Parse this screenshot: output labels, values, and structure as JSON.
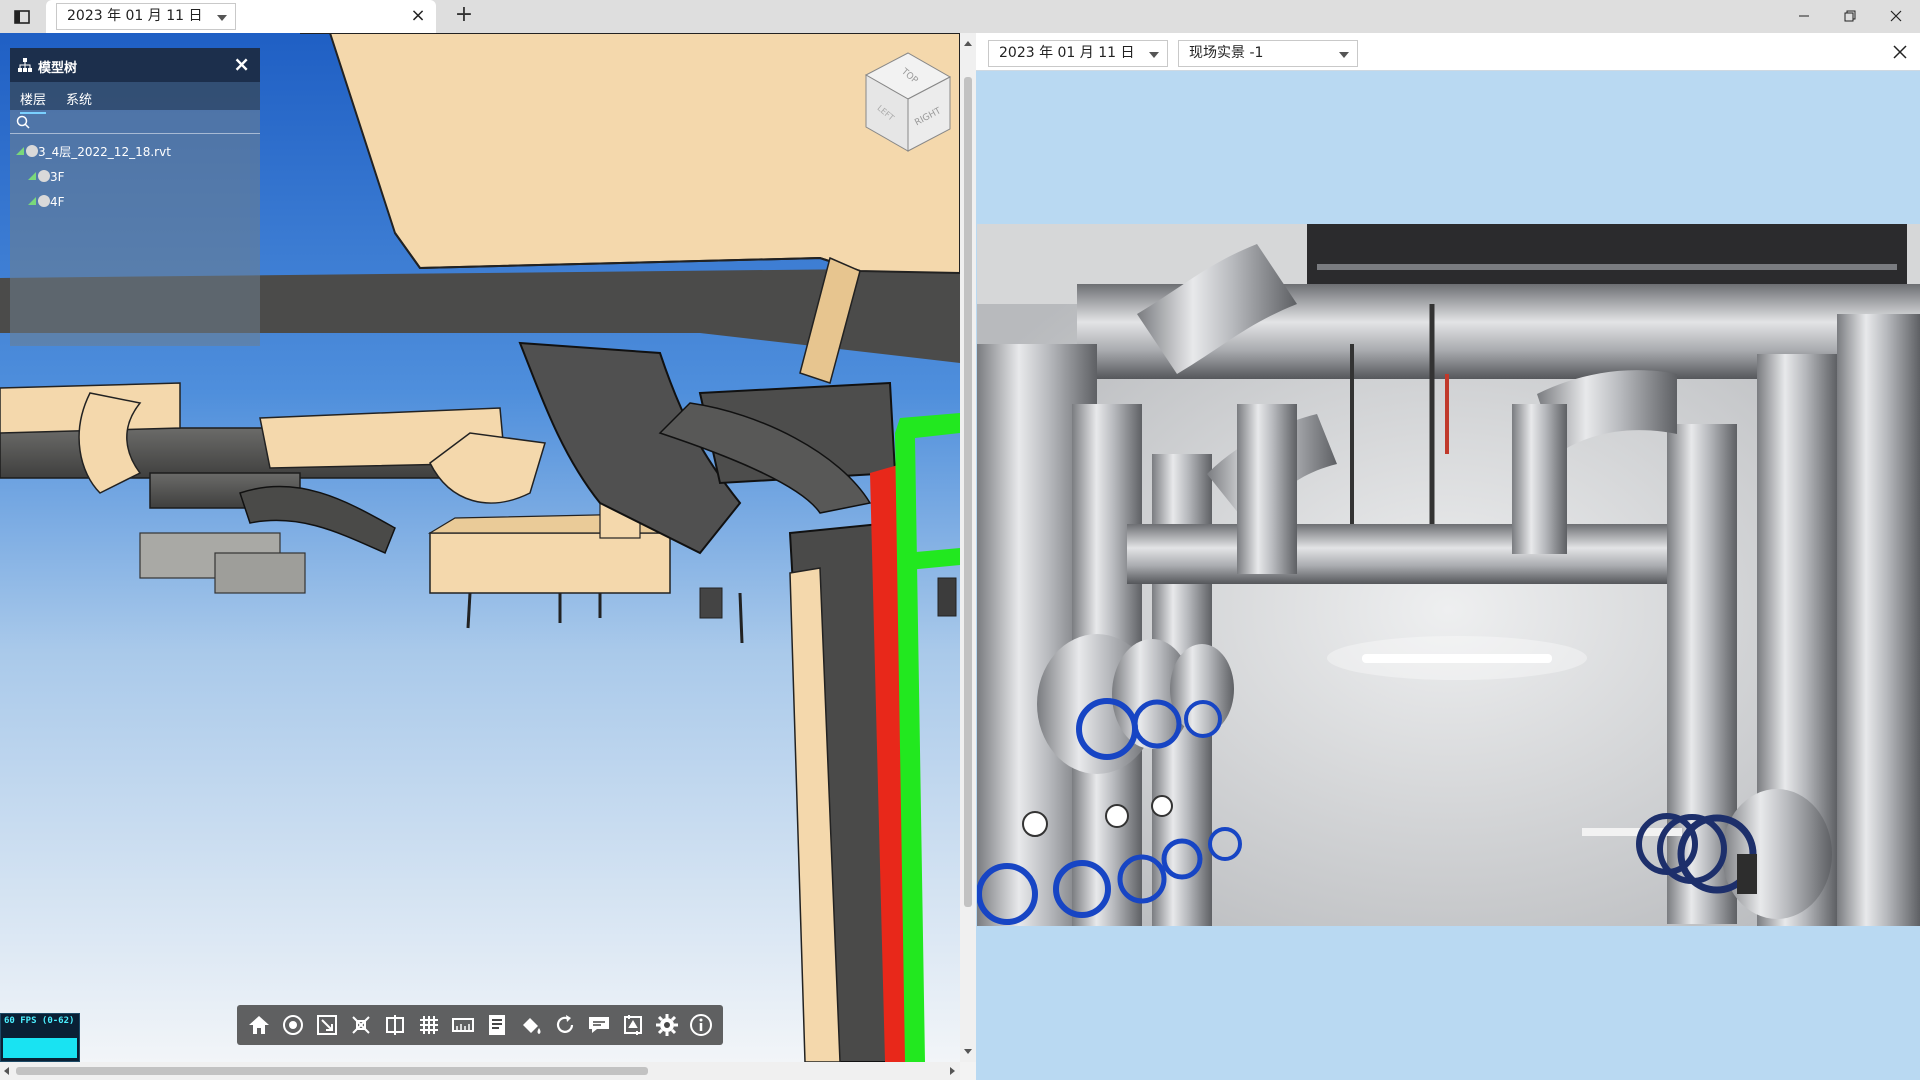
{
  "titlebar": {
    "tab_date": "2023 年 01 月 11 日",
    "tab_close_glyph": "×",
    "new_tab_glyph": "+"
  },
  "model_tree": {
    "title": "模型树",
    "close_glyph": "×",
    "tabs": [
      {
        "label": "楼层",
        "active": true
      },
      {
        "label": "系统",
        "active": false
      }
    ],
    "root": "3_4层_2022_12_18.rvt",
    "children": [
      "3F",
      "4F"
    ]
  },
  "viewcube": {
    "faces": [
      "TOP",
      "LEFT",
      "RIGHT"
    ]
  },
  "fps": {
    "label": "60 FPS (0-62)"
  },
  "toolbar": {
    "icons": [
      "home-icon",
      "orbit-icon",
      "fit-view-icon",
      "explode-icon",
      "section-box-icon",
      "grid-icon",
      "measure-icon",
      "properties-icon",
      "paint-icon",
      "rotate-icon",
      "comment-icon",
      "screenshot-icon",
      "settings-icon",
      "info-icon"
    ]
  },
  "right_panel": {
    "date": "2023 年 01 月 11 日",
    "scene": "现场实景 -1",
    "close_glyph": "×"
  },
  "colors": {
    "sky_top": "#2f6fcf",
    "sky_bottom": "#eef3f8",
    "duct_tan": "#f4d8ac",
    "pipe_gray": "#5a5a58",
    "pipe_green": "#22e81f",
    "pipe_red": "#e8281a",
    "right_bg": "#b9d9f2"
  }
}
